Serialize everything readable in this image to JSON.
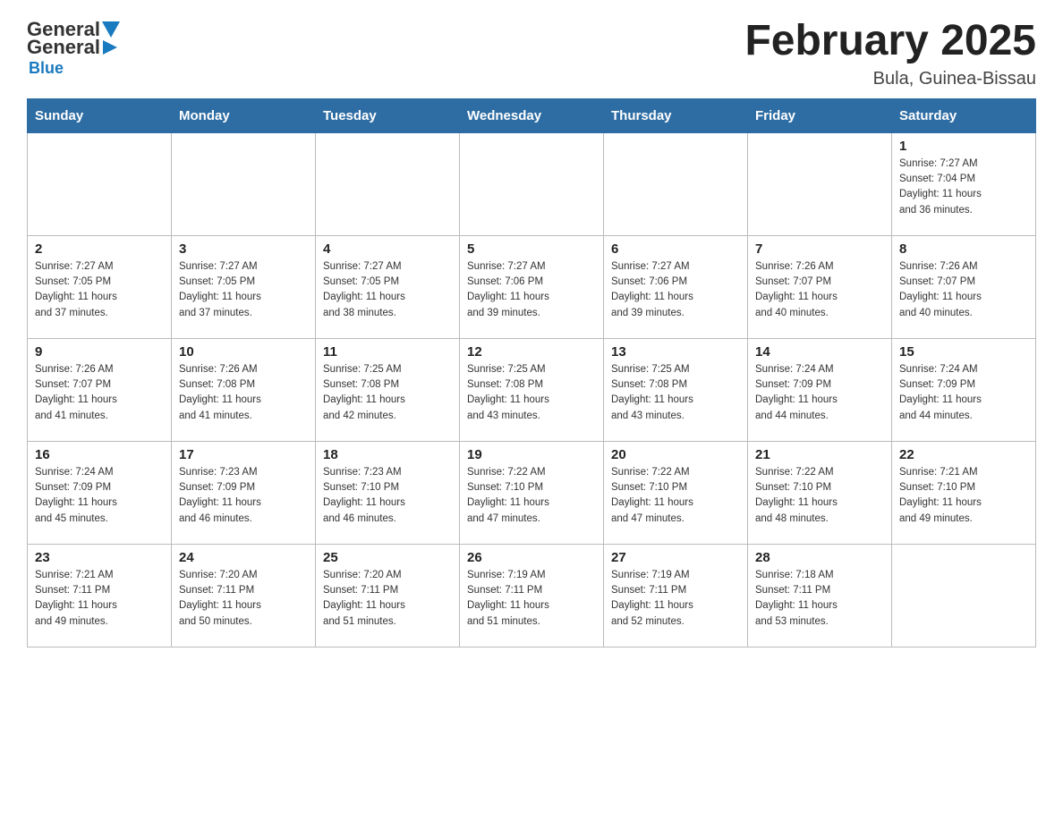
{
  "logo": {
    "general": "General",
    "blue": "Blue"
  },
  "title": "February 2025",
  "location": "Bula, Guinea-Bissau",
  "days_of_week": [
    "Sunday",
    "Monday",
    "Tuesday",
    "Wednesday",
    "Thursday",
    "Friday",
    "Saturday"
  ],
  "weeks": [
    [
      {
        "day": "",
        "info": ""
      },
      {
        "day": "",
        "info": ""
      },
      {
        "day": "",
        "info": ""
      },
      {
        "day": "",
        "info": ""
      },
      {
        "day": "",
        "info": ""
      },
      {
        "day": "",
        "info": ""
      },
      {
        "day": "1",
        "info": "Sunrise: 7:27 AM\nSunset: 7:04 PM\nDaylight: 11 hours\nand 36 minutes."
      }
    ],
    [
      {
        "day": "2",
        "info": "Sunrise: 7:27 AM\nSunset: 7:05 PM\nDaylight: 11 hours\nand 37 minutes."
      },
      {
        "day": "3",
        "info": "Sunrise: 7:27 AM\nSunset: 7:05 PM\nDaylight: 11 hours\nand 37 minutes."
      },
      {
        "day": "4",
        "info": "Sunrise: 7:27 AM\nSunset: 7:05 PM\nDaylight: 11 hours\nand 38 minutes."
      },
      {
        "day": "5",
        "info": "Sunrise: 7:27 AM\nSunset: 7:06 PM\nDaylight: 11 hours\nand 39 minutes."
      },
      {
        "day": "6",
        "info": "Sunrise: 7:27 AM\nSunset: 7:06 PM\nDaylight: 11 hours\nand 39 minutes."
      },
      {
        "day": "7",
        "info": "Sunrise: 7:26 AM\nSunset: 7:07 PM\nDaylight: 11 hours\nand 40 minutes."
      },
      {
        "day": "8",
        "info": "Sunrise: 7:26 AM\nSunset: 7:07 PM\nDaylight: 11 hours\nand 40 minutes."
      }
    ],
    [
      {
        "day": "9",
        "info": "Sunrise: 7:26 AM\nSunset: 7:07 PM\nDaylight: 11 hours\nand 41 minutes."
      },
      {
        "day": "10",
        "info": "Sunrise: 7:26 AM\nSunset: 7:08 PM\nDaylight: 11 hours\nand 41 minutes."
      },
      {
        "day": "11",
        "info": "Sunrise: 7:25 AM\nSunset: 7:08 PM\nDaylight: 11 hours\nand 42 minutes."
      },
      {
        "day": "12",
        "info": "Sunrise: 7:25 AM\nSunset: 7:08 PM\nDaylight: 11 hours\nand 43 minutes."
      },
      {
        "day": "13",
        "info": "Sunrise: 7:25 AM\nSunset: 7:08 PM\nDaylight: 11 hours\nand 43 minutes."
      },
      {
        "day": "14",
        "info": "Sunrise: 7:24 AM\nSunset: 7:09 PM\nDaylight: 11 hours\nand 44 minutes."
      },
      {
        "day": "15",
        "info": "Sunrise: 7:24 AM\nSunset: 7:09 PM\nDaylight: 11 hours\nand 44 minutes."
      }
    ],
    [
      {
        "day": "16",
        "info": "Sunrise: 7:24 AM\nSunset: 7:09 PM\nDaylight: 11 hours\nand 45 minutes."
      },
      {
        "day": "17",
        "info": "Sunrise: 7:23 AM\nSunset: 7:09 PM\nDaylight: 11 hours\nand 46 minutes."
      },
      {
        "day": "18",
        "info": "Sunrise: 7:23 AM\nSunset: 7:10 PM\nDaylight: 11 hours\nand 46 minutes."
      },
      {
        "day": "19",
        "info": "Sunrise: 7:22 AM\nSunset: 7:10 PM\nDaylight: 11 hours\nand 47 minutes."
      },
      {
        "day": "20",
        "info": "Sunrise: 7:22 AM\nSunset: 7:10 PM\nDaylight: 11 hours\nand 47 minutes."
      },
      {
        "day": "21",
        "info": "Sunrise: 7:22 AM\nSunset: 7:10 PM\nDaylight: 11 hours\nand 48 minutes."
      },
      {
        "day": "22",
        "info": "Sunrise: 7:21 AM\nSunset: 7:10 PM\nDaylight: 11 hours\nand 49 minutes."
      }
    ],
    [
      {
        "day": "23",
        "info": "Sunrise: 7:21 AM\nSunset: 7:11 PM\nDaylight: 11 hours\nand 49 minutes."
      },
      {
        "day": "24",
        "info": "Sunrise: 7:20 AM\nSunset: 7:11 PM\nDaylight: 11 hours\nand 50 minutes."
      },
      {
        "day": "25",
        "info": "Sunrise: 7:20 AM\nSunset: 7:11 PM\nDaylight: 11 hours\nand 51 minutes."
      },
      {
        "day": "26",
        "info": "Sunrise: 7:19 AM\nSunset: 7:11 PM\nDaylight: 11 hours\nand 51 minutes."
      },
      {
        "day": "27",
        "info": "Sunrise: 7:19 AM\nSunset: 7:11 PM\nDaylight: 11 hours\nand 52 minutes."
      },
      {
        "day": "28",
        "info": "Sunrise: 7:18 AM\nSunset: 7:11 PM\nDaylight: 11 hours\nand 53 minutes."
      },
      {
        "day": "",
        "info": ""
      }
    ]
  ]
}
